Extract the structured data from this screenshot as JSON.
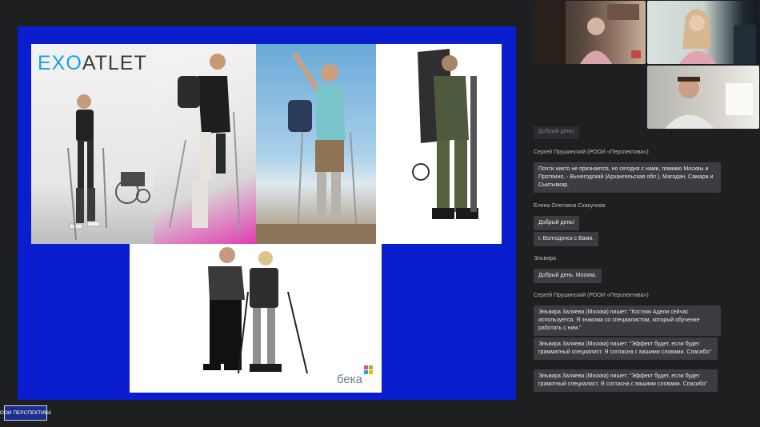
{
  "slide": {
    "logo_brand_prefix": "EX",
    "logo_brand_o": "O",
    "logo_brand_suffix": "ATLET",
    "logo_beka": "бека"
  },
  "chat": {
    "partial_top": "Добрый день!",
    "messages": [
      {
        "sender": "Сергей Прушинский (РООИ «Перспектива»)",
        "bubbles": [
          "Почти никто не признается, но сегодня с нами, помимо Москвы и Протвино, - Вычегодский (Архангельская обл.), Магадан, Самара и Сыктывкар."
        ]
      },
      {
        "sender": "Елена Олеговна Скакунова",
        "bubbles": [
          "Добрый день!",
          "г. Волгодонск с Вами."
        ]
      },
      {
        "sender": "Эльвира",
        "bubbles": [
          "Добрый день. Москва."
        ]
      },
      {
        "sender": "Сергей Прушинский (РООИ «Перспектива»)",
        "bubbles": [
          "Эльвира Заляева (Москва) пишет: \"Костюм Адели сейчас используется. Я знакома со специалистом, который обучение работать с ним.\"",
          "Эльвира Заляева (Москва) пишет: \"Эффект будет, если будет грамматный специалист. Я согласна с вашими словами. Спасибо\"",
          "Эльвира Заляева (Москва) пишет: \"Эффект будет, если будет грамотный специалист. Я согласна с вашими словами. Спасибо\""
        ]
      }
    ]
  },
  "footer": {
    "org_label": "ООИ ПЕРСПЕКТИВА"
  },
  "colors": {
    "background": "#1e1f21",
    "slide_blue": "#0a1ed0",
    "bubble": "#3c3d40",
    "accent_exo": "#1aa0e0"
  }
}
